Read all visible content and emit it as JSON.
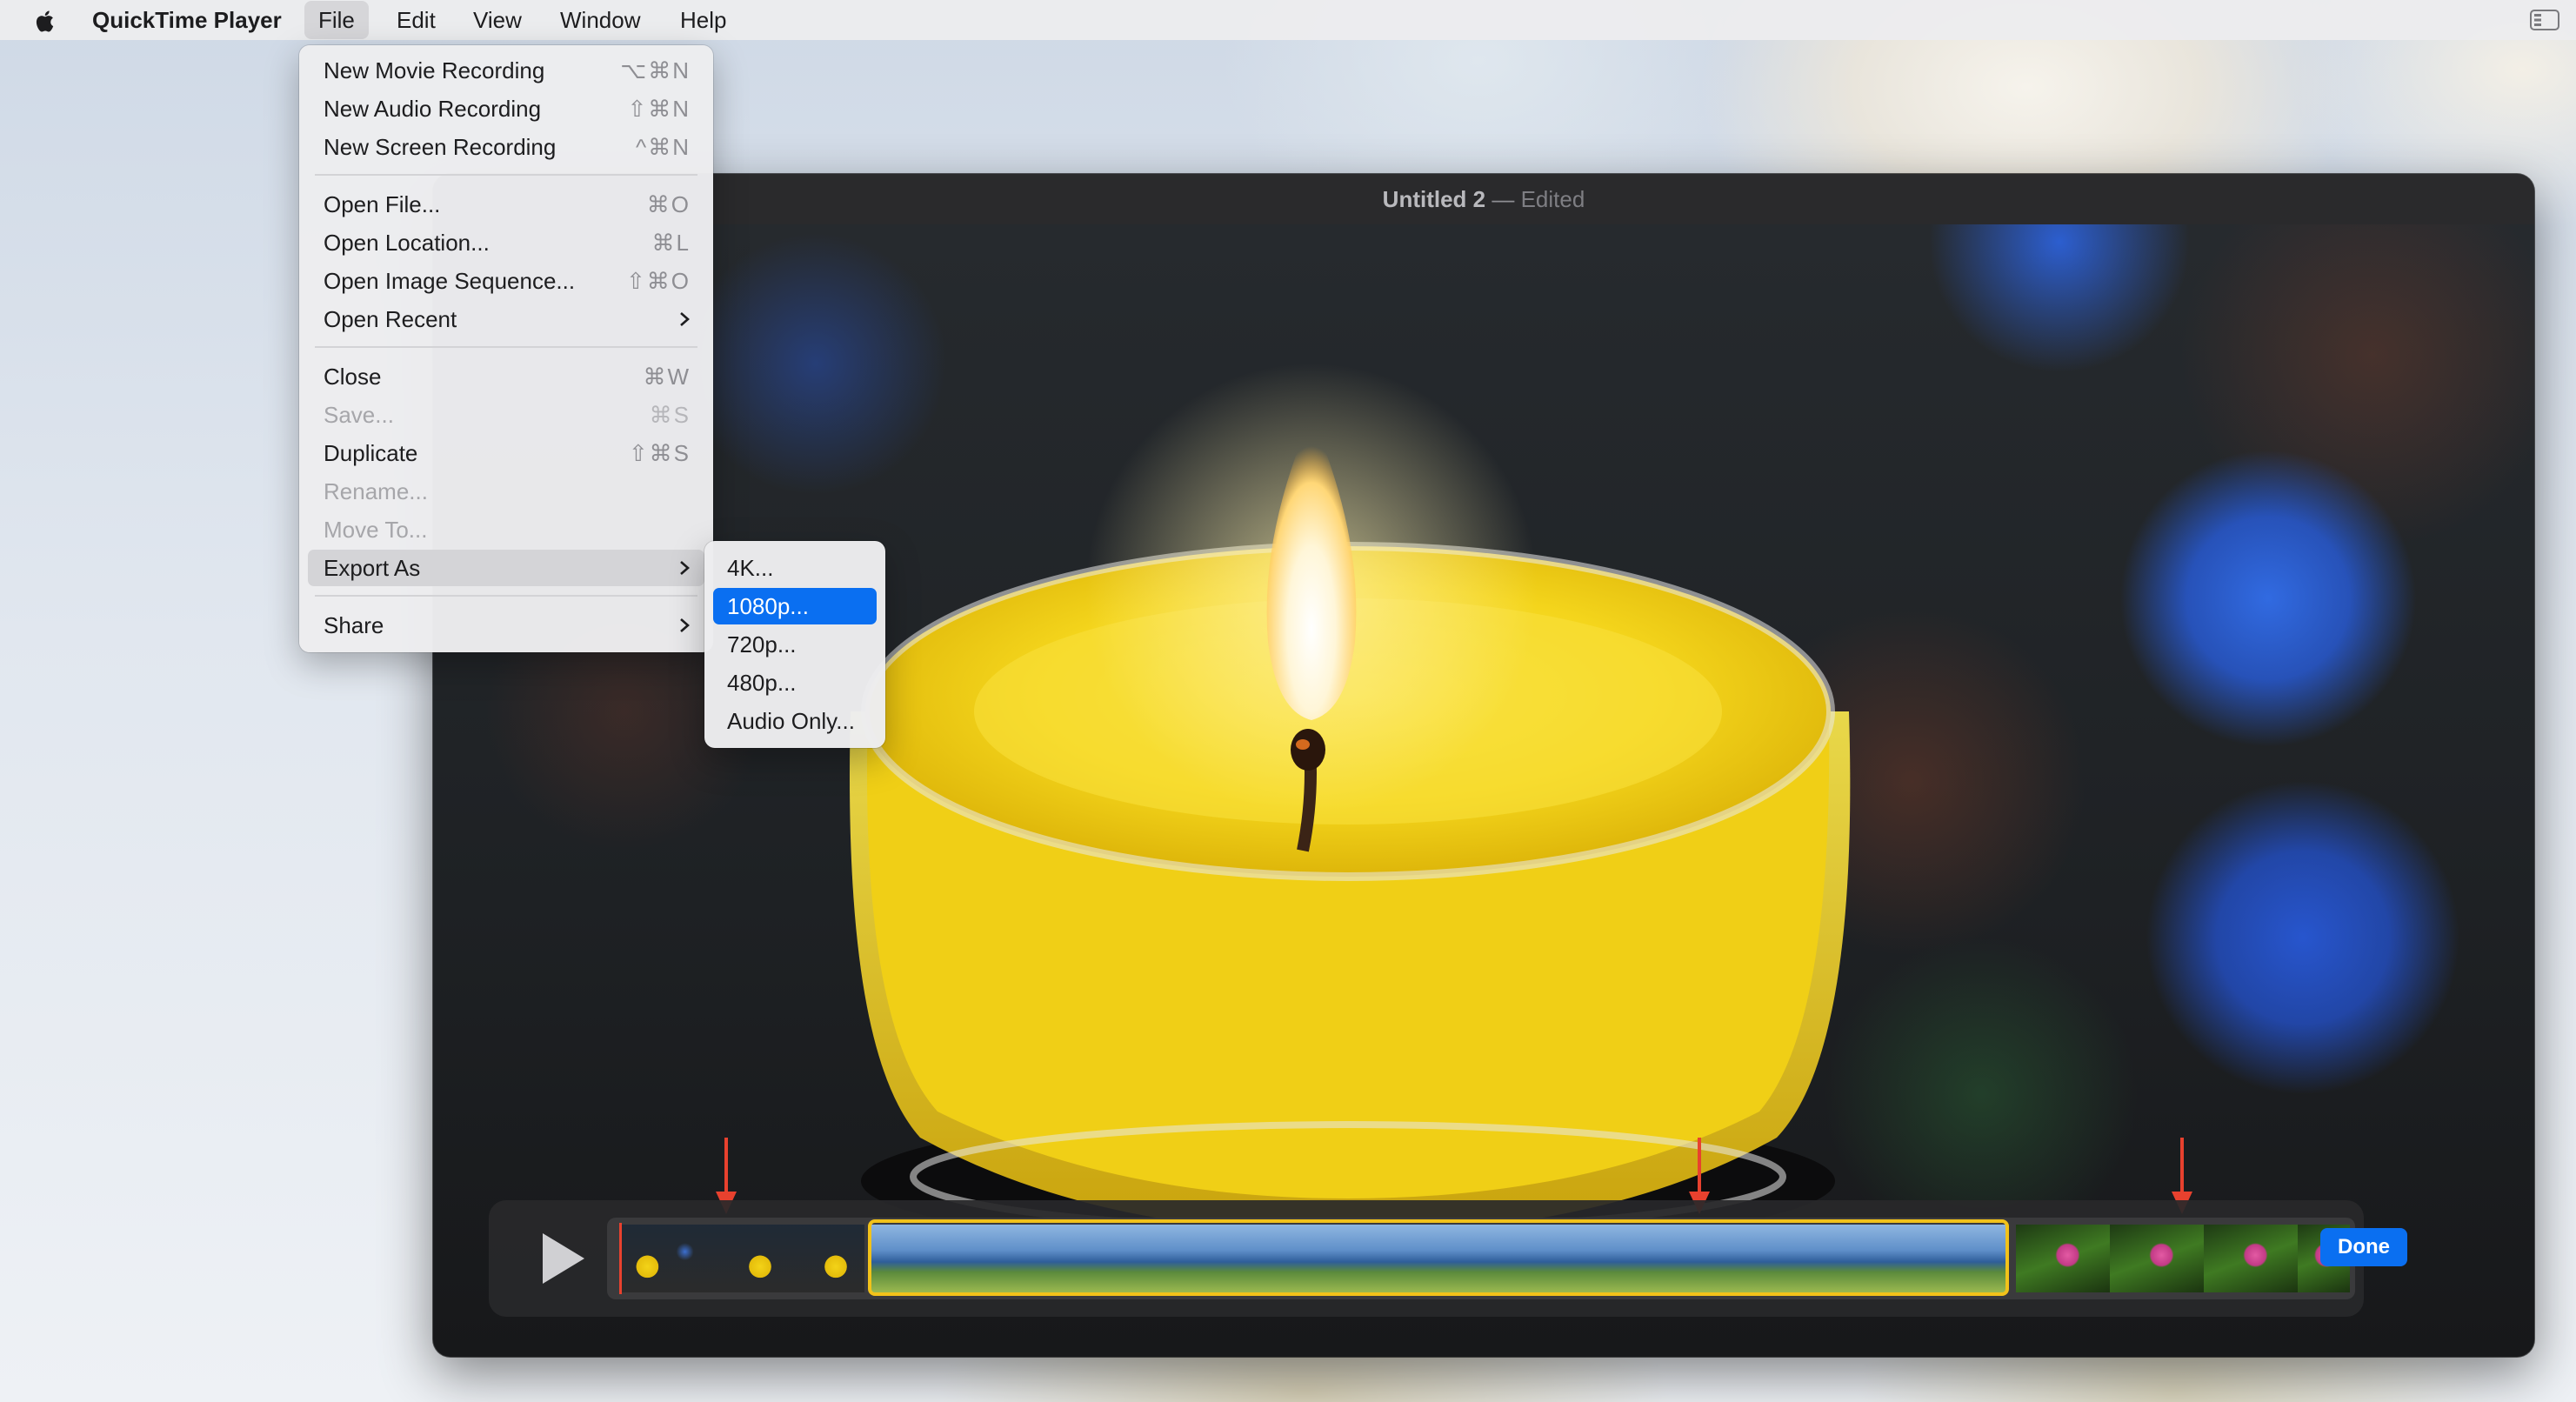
{
  "menubar": {
    "app_name": "QuickTime Player",
    "menus": [
      "File",
      "Edit",
      "View",
      "Window",
      "Help"
    ]
  },
  "window": {
    "title": "Untitled 2",
    "separator": "—",
    "status": "Edited"
  },
  "file_menu": {
    "items": [
      {
        "label": "New Movie Recording",
        "shortcut": "⌥⌘N"
      },
      {
        "label": "New Audio Recording",
        "shortcut": "⇧⌘N"
      },
      {
        "label": "New Screen Recording",
        "shortcut": "^⌘N"
      },
      {
        "label": "Open File...",
        "shortcut": "⌘O"
      },
      {
        "label": "Open Location...",
        "shortcut": "⌘L"
      },
      {
        "label": "Open Image Sequence...",
        "shortcut": "⇧⌘O"
      },
      {
        "label": "Open Recent",
        "shortcut": ""
      },
      {
        "label": "Close",
        "shortcut": "⌘W"
      },
      {
        "label": "Save...",
        "shortcut": "⌘S"
      },
      {
        "label": "Duplicate",
        "shortcut": "⇧⌘S"
      },
      {
        "label": "Rename...",
        "shortcut": ""
      },
      {
        "label": "Move To...",
        "shortcut": ""
      },
      {
        "label": "Export As",
        "shortcut": ""
      },
      {
        "label": "Share",
        "shortcut": ""
      }
    ]
  },
  "export_menu": {
    "items": [
      "4K...",
      "1080p...",
      "720p...",
      "480p...",
      "Audio Only..."
    ],
    "selected": "1080p..."
  },
  "trim": {
    "done_label": "Done"
  },
  "colors": {
    "accent": "#0a6ff1",
    "selection_border": "#f2c21a",
    "marker_arrow": "#e8412e"
  }
}
